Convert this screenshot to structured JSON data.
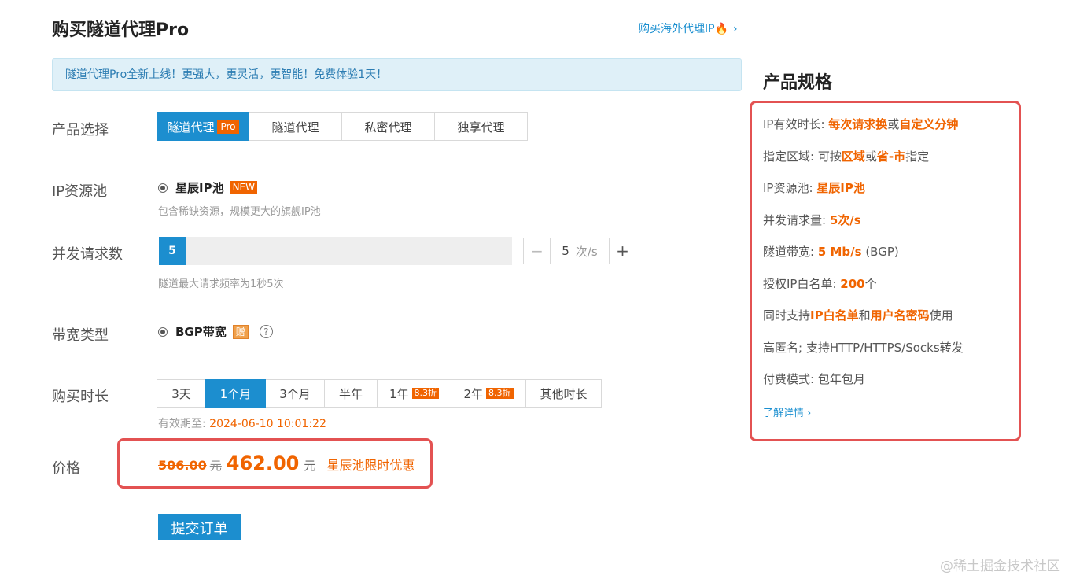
{
  "header": {
    "title": "购买隧道代理Pro",
    "overseas_link": "购买海外代理IP",
    "overseas_icon": "fire-icon",
    "overseas_chevron": "›"
  },
  "notice": "隧道代理Pro全新上线！更强大，更灵活，更智能！免费体验1天！",
  "product": {
    "label": "产品选择",
    "options": [
      {
        "label": "隧道代理",
        "tag": "Pro",
        "active": true
      },
      {
        "label": "隧道代理",
        "active": false
      },
      {
        "label": "私密代理",
        "active": false
      },
      {
        "label": "独享代理",
        "active": false
      }
    ]
  },
  "pool": {
    "label": "IP资源池",
    "option": "星辰IP池",
    "badge": "NEW",
    "hint": "包含稀缺资源，规模更大的旗舰IP池"
  },
  "concurrency": {
    "label": "并发请求数",
    "value": "5",
    "slider_fraction": 0.075,
    "stepper_minus": "−",
    "stepper_value": "5",
    "stepper_unit": "次/s",
    "stepper_plus": "+",
    "hint": "隧道最大请求频率为1秒5次"
  },
  "bandwidth": {
    "label": "带宽类型",
    "option": "BGP带宽",
    "gift": "赠",
    "help": "?"
  },
  "duration": {
    "label": "购买时长",
    "options": [
      {
        "label": "3天",
        "active": false
      },
      {
        "label": "1个月",
        "active": true
      },
      {
        "label": "3个月",
        "active": false
      },
      {
        "label": "半年",
        "active": false
      },
      {
        "label": "1年",
        "tag": "8.3折",
        "active": false
      },
      {
        "label": "2年",
        "tag": "8.3折",
        "active": false
      },
      {
        "label": "其他时长",
        "active": false
      }
    ],
    "expire_prefix": "有效期至:",
    "expire_date": "2024-06-10 10:01:22"
  },
  "price": {
    "label": "价格",
    "old": "506.00",
    "old_unit": "元",
    "new": "462.00",
    "unit": "元",
    "promo": "星辰池限时优惠"
  },
  "submit": "提交订单",
  "spec": {
    "title": "产品规格",
    "lines": [
      [
        {
          "t": "IP有效时长: "
        },
        {
          "t": "每次请求换",
          "hl": true
        },
        {
          "t": "或"
        },
        {
          "t": "自定义分钟",
          "hl": true
        }
      ],
      [
        {
          "t": "指定区域: 可按"
        },
        {
          "t": "区域",
          "hl": true
        },
        {
          "t": "或"
        },
        {
          "t": "省-市",
          "hl": true
        },
        {
          "t": "指定"
        }
      ],
      [
        {
          "t": "IP资源池: "
        },
        {
          "t": "星辰IP池",
          "hl": true
        }
      ],
      [
        {
          "t": "并发请求量: "
        },
        {
          "t": "5次/s",
          "hl": true
        }
      ],
      [
        {
          "t": "隧道带宽: "
        },
        {
          "t": "5 Mb/s",
          "hl": true
        },
        {
          "t": " (BGP)"
        }
      ],
      [
        {
          "t": "授权IP白名单: "
        },
        {
          "t": "200",
          "hl": true
        },
        {
          "t": "个"
        }
      ],
      [
        {
          "t": "同时支持"
        },
        {
          "t": "IP白名单",
          "hl": true
        },
        {
          "t": "和"
        },
        {
          "t": "用户名密码",
          "hl": true
        },
        {
          "t": "使用"
        }
      ],
      [
        {
          "t": "高匿名; 支持HTTP/HTTPS/Socks转发"
        }
      ],
      [
        {
          "t": "付费模式: 包年包月"
        }
      ]
    ],
    "more": "了解详情 ›"
  },
  "watermark": "@稀土掘金技术社区",
  "colors": {
    "accent": "#1c8ecf",
    "highlight": "#f06400",
    "frame": "#e35252"
  }
}
